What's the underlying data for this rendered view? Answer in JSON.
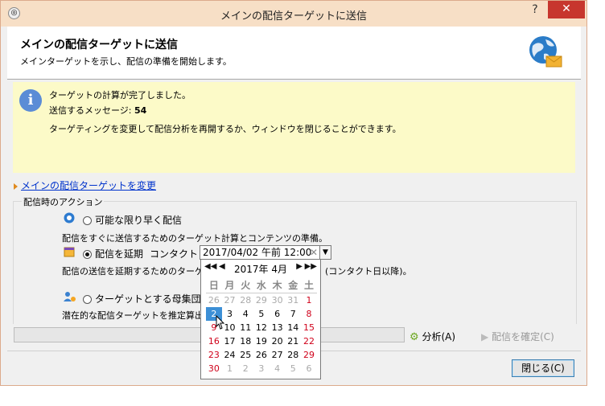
{
  "window": {
    "title": "メインの配信ターゲットに送信"
  },
  "header": {
    "title": "メインの配信ターゲットに送信",
    "subtitle": "メインターゲットを示し、配信の準備を開始します。"
  },
  "info": {
    "line1": "ターゲットの計算が完了しました。",
    "messages_label": "送信するメッセージ:",
    "messages_count": "54",
    "line3": "ターゲティングを変更して配信分析を再開するか、ウィンドウを閉じることができます。"
  },
  "change_target_link": "メインの配信ターゲットを変更",
  "actions": {
    "group_label": "配信時のアクション",
    "asap_label": "可能な限り早く配信",
    "asap_desc": "配信をすぐに送信するためのターゲット計算とコンテンツの準備。",
    "postpone_label": "配信を延期",
    "contact_date_label": "コンタクト日:",
    "contact_date_value": "2017/04/02 午前 12:00",
    "postpone_desc_part1": "配信の送信を延期するためのターゲッ",
    "postpone_desc_part2": "(コンタクト日以降)。",
    "estimate_label": "ターゲットとする母集団を推",
    "estimate_desc": "潜在的な配信ターゲットを推定算出"
  },
  "buttons": {
    "analyze": "分析(A)",
    "confirm": "配信を確定(C)",
    "close": "閉じる(C)"
  },
  "calendar": {
    "month_title": "2017年 4月",
    "weekdays": [
      "日",
      "月",
      "火",
      "水",
      "木",
      "金",
      "土"
    ],
    "weeks": [
      [
        "26",
        "27",
        "28",
        "29",
        "30",
        "31",
        "1"
      ],
      [
        "2",
        "3",
        "4",
        "5",
        "6",
        "7",
        "8"
      ],
      [
        "9",
        "10",
        "11",
        "12",
        "13",
        "14",
        "15"
      ],
      [
        "16",
        "17",
        "18",
        "19",
        "20",
        "21",
        "22"
      ],
      [
        "23",
        "24",
        "25",
        "26",
        "27",
        "28",
        "29"
      ],
      [
        "30",
        "1",
        "2",
        "3",
        "4",
        "5",
        "6"
      ]
    ],
    "selected": "2"
  }
}
